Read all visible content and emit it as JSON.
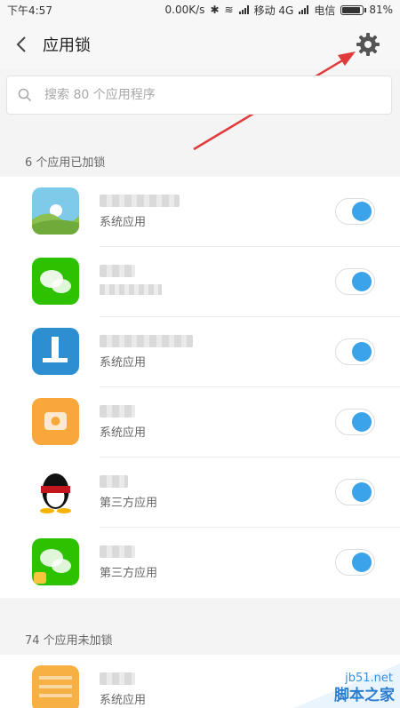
{
  "status_bar": {
    "time": "下午4:57",
    "speed": "0.00K/s",
    "carrier1": "移动 4G",
    "carrier2": "电信",
    "battery": "81%",
    "battery_level": 0.81
  },
  "header": {
    "back_icon": "chevron-left-icon",
    "title": "应用锁",
    "settings_icon": "gear-icon"
  },
  "search": {
    "placeholder": "搜索 80 个应用程序"
  },
  "locked_section": {
    "label": "6 个应用已加锁",
    "apps": [
      {
        "icon": "gallery-icon",
        "subtitle": "系统应用",
        "locked": true
      },
      {
        "icon": "wechat-icon",
        "subtitle": "",
        "locked": true
      },
      {
        "icon": "blue-app-icon",
        "subtitle": "系统应用",
        "locked": true
      },
      {
        "icon": "orange-app-icon",
        "subtitle": "系统应用",
        "locked": true
      },
      {
        "icon": "qq-icon",
        "subtitle": "第三方应用",
        "locked": true
      },
      {
        "icon": "wechat-icon",
        "subtitle": "第三方应用",
        "locked": true
      }
    ]
  },
  "unlocked_section": {
    "label": "74 个应用未加锁",
    "apps": [
      {
        "icon": "notes-icon",
        "subtitle": "系统应用"
      }
    ]
  },
  "watermark": {
    "line1": "jb51.net",
    "line2": "脚本之家"
  },
  "colors": {
    "accent": "#3aa3ea",
    "arrow": "#e03a3a"
  }
}
